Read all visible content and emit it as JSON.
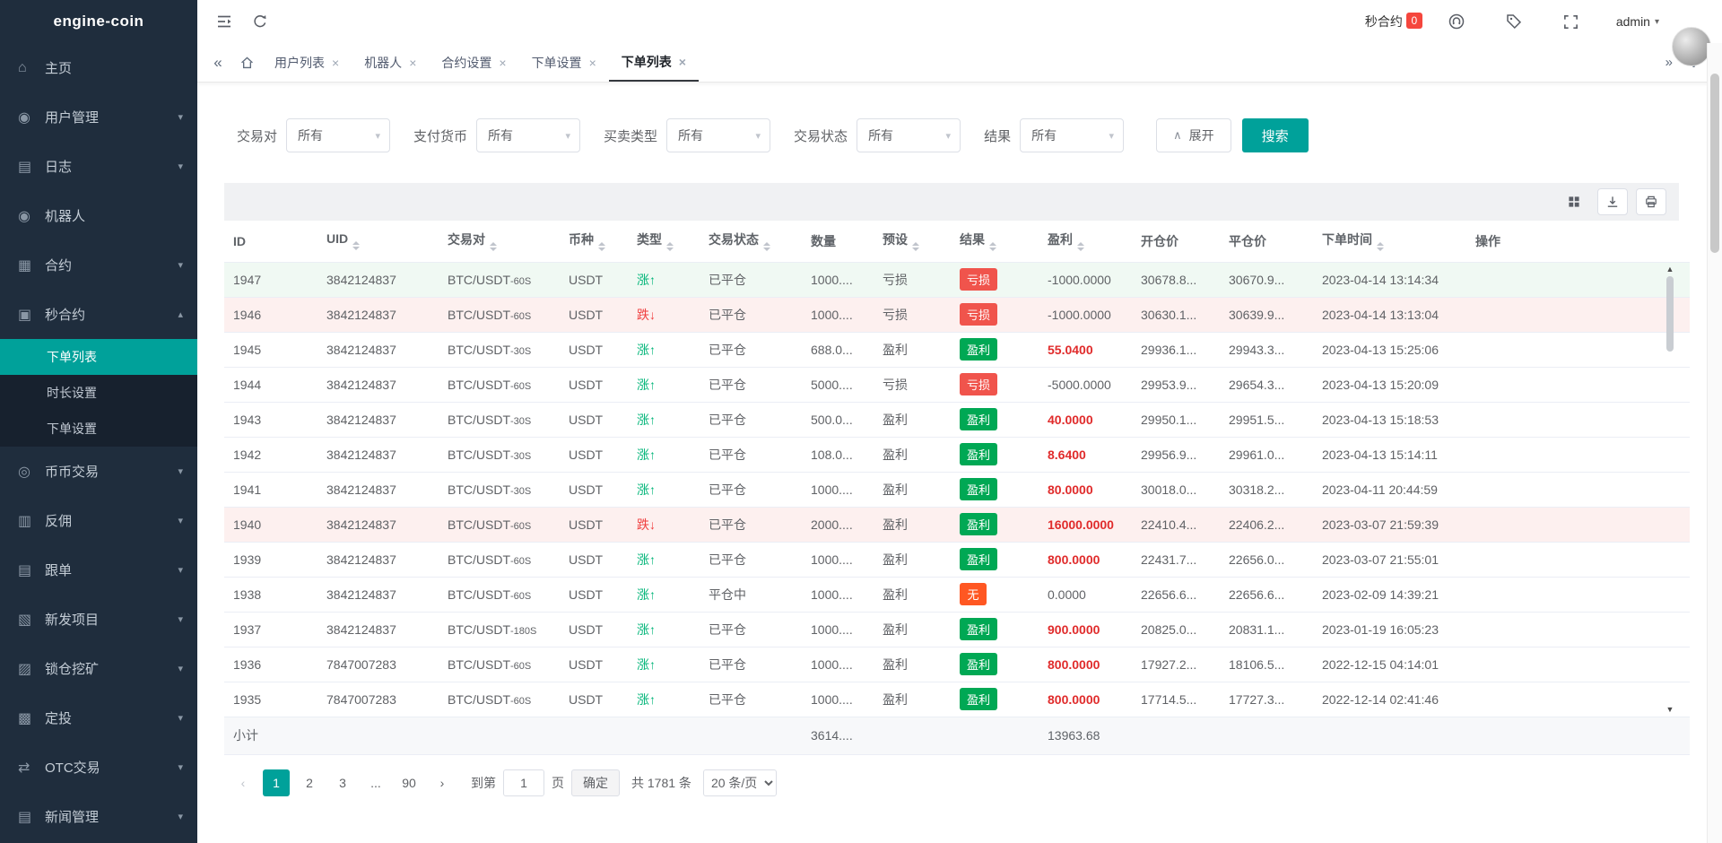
{
  "brand": "engine-coin",
  "colors": {
    "accent": "#00a19a",
    "sidebar_bg": "#1f2d3d",
    "submenu_bg": "#17212e",
    "badge_red": "#f5463d",
    "win_green": "#00a854",
    "loss_red": "#f0544c",
    "none_orange": "#ff5722",
    "up_green": "#00b578",
    "down_red": "#f03e3e",
    "profit_red": "#e02b2b",
    "row_pink": "#fdf0ef",
    "row_green": "#f0f9f3"
  },
  "sidebar": {
    "items": [
      {
        "icon": "home",
        "label": "主页"
      },
      {
        "icon": "user",
        "label": "用户管理",
        "chevron": "down"
      },
      {
        "icon": "log",
        "label": "日志",
        "chevron": "down"
      },
      {
        "icon": "robot",
        "label": "机器人"
      },
      {
        "icon": "contract",
        "label": "合约",
        "chevron": "down"
      },
      {
        "icon": "seconds",
        "label": "秒合约",
        "chevron": "up",
        "expanded": true,
        "children": [
          {
            "label": "下单列表",
            "active": true
          },
          {
            "label": "时长设置"
          },
          {
            "label": "下单设置"
          }
        ]
      },
      {
        "icon": "coin",
        "label": "币币交易",
        "chevron": "down"
      },
      {
        "icon": "rebate",
        "label": "反佣",
        "chevron": "down"
      },
      {
        "icon": "follow",
        "label": "跟单",
        "chevron": "down"
      },
      {
        "icon": "newproj",
        "label": "新发项目",
        "chevron": "down"
      },
      {
        "icon": "lock",
        "label": "锁仓挖矿",
        "chevron": "down"
      },
      {
        "icon": "invest",
        "label": "定投",
        "chevron": "down"
      },
      {
        "icon": "otc",
        "label": "OTC交易",
        "chevron": "down"
      },
      {
        "icon": "news",
        "label": "新闻管理",
        "chevron": "down"
      }
    ]
  },
  "topbar": {
    "badge_label": "秒合约",
    "badge_count": "0",
    "username": "admin"
  },
  "tabs": [
    {
      "label": "用户列表"
    },
    {
      "label": "机器人"
    },
    {
      "label": "合约设置"
    },
    {
      "label": "下单设置"
    },
    {
      "label": "下单列表",
      "active": true
    }
  ],
  "filters": [
    {
      "label": "交易对",
      "value": "所有"
    },
    {
      "label": "支付货币",
      "value": "所有"
    },
    {
      "label": "买卖类型",
      "value": "所有"
    },
    {
      "label": "交易状态",
      "value": "所有"
    },
    {
      "label": "结果",
      "value": "所有"
    }
  ],
  "actions": {
    "expand": "展开",
    "search": "搜索"
  },
  "table": {
    "columns": [
      {
        "label": "ID",
        "sortable": false
      },
      {
        "label": "UID",
        "sortable": true
      },
      {
        "label": "交易对",
        "sortable": true
      },
      {
        "label": "币种",
        "sortable": true
      },
      {
        "label": "类型",
        "sortable": true
      },
      {
        "label": "交易状态",
        "sortable": true
      },
      {
        "label": "数量",
        "sortable": false
      },
      {
        "label": "预设",
        "sortable": true
      },
      {
        "label": "结果",
        "sortable": true
      },
      {
        "label": "盈利",
        "sortable": true
      },
      {
        "label": "开仓价",
        "sortable": false
      },
      {
        "label": "平仓价",
        "sortable": false
      },
      {
        "label": "下单时间",
        "sortable": true
      },
      {
        "label": "操作",
        "sortable": false
      }
    ],
    "rows": [
      {
        "id": "1947",
        "uid": "3842124837",
        "pair": "BTC/USDT",
        "period": "60S",
        "coin": "USDT",
        "type": "涨",
        "dir": "up",
        "status": "已平仓",
        "qty": "1000....",
        "preset": "亏损",
        "result": "亏损",
        "result_style": "loss",
        "profit": "-1000.0000",
        "profit_style": "plain",
        "open": "30678.8...",
        "close": "30670.9...",
        "time": "2023-04-14 13:14:34",
        "bg": "green"
      },
      {
        "id": "1946",
        "uid": "3842124837",
        "pair": "BTC/USDT",
        "period": "60S",
        "coin": "USDT",
        "type": "跌",
        "dir": "down",
        "status": "已平仓",
        "qty": "1000....",
        "preset": "亏损",
        "result": "亏损",
        "result_style": "loss",
        "profit": "-1000.0000",
        "profit_style": "plain",
        "open": "30630.1...",
        "close": "30639.9...",
        "time": "2023-04-14 13:13:04",
        "bg": "pink"
      },
      {
        "id": "1945",
        "uid": "3842124837",
        "pair": "BTC/USDT",
        "period": "30S",
        "coin": "USDT",
        "type": "涨",
        "dir": "up",
        "status": "已平仓",
        "qty": "688.0...",
        "preset": "盈利",
        "result": "盈利",
        "result_style": "win",
        "profit": "55.0400",
        "profit_style": "red",
        "open": "29936.1...",
        "close": "29943.3...",
        "time": "2023-04-13 15:25:06",
        "bg": "white"
      },
      {
        "id": "1944",
        "uid": "3842124837",
        "pair": "BTC/USDT",
        "period": "60S",
        "coin": "USDT",
        "type": "涨",
        "dir": "up",
        "status": "已平仓",
        "qty": "5000....",
        "preset": "亏损",
        "result": "亏损",
        "result_style": "loss",
        "profit": "-5000.0000",
        "profit_style": "plain",
        "open": "29953.9...",
        "close": "29654.3...",
        "time": "2023-04-13 15:20:09",
        "bg": "white"
      },
      {
        "id": "1943",
        "uid": "3842124837",
        "pair": "BTC/USDT",
        "period": "30S",
        "coin": "USDT",
        "type": "涨",
        "dir": "up",
        "status": "已平仓",
        "qty": "500.0...",
        "preset": "盈利",
        "result": "盈利",
        "result_style": "win",
        "profit": "40.0000",
        "profit_style": "red",
        "open": "29950.1...",
        "close": "29951.5...",
        "time": "2023-04-13 15:18:53",
        "bg": "white"
      },
      {
        "id": "1942",
        "uid": "3842124837",
        "pair": "BTC/USDT",
        "period": "30S",
        "coin": "USDT",
        "type": "涨",
        "dir": "up",
        "status": "已平仓",
        "qty": "108.0...",
        "preset": "盈利",
        "result": "盈利",
        "result_style": "win",
        "profit": "8.6400",
        "profit_style": "red",
        "open": "29956.9...",
        "close": "29961.0...",
        "time": "2023-04-13 15:14:11",
        "bg": "white"
      },
      {
        "id": "1941",
        "uid": "3842124837",
        "pair": "BTC/USDT",
        "period": "30S",
        "coin": "USDT",
        "type": "涨",
        "dir": "up",
        "status": "已平仓",
        "qty": "1000....",
        "preset": "盈利",
        "result": "盈利",
        "result_style": "win",
        "profit": "80.0000",
        "profit_style": "red",
        "open": "30018.0...",
        "close": "30318.2...",
        "time": "2023-04-11 20:44:59",
        "bg": "white"
      },
      {
        "id": "1940",
        "uid": "3842124837",
        "pair": "BTC/USDT",
        "period": "60S",
        "coin": "USDT",
        "type": "跌",
        "dir": "down",
        "status": "已平仓",
        "qty": "2000....",
        "preset": "盈利",
        "result": "盈利",
        "result_style": "win",
        "profit": "16000.0000",
        "profit_style": "red",
        "open": "22410.4...",
        "close": "22406.2...",
        "time": "2023-03-07 21:59:39",
        "bg": "pink"
      },
      {
        "id": "1939",
        "uid": "3842124837",
        "pair": "BTC/USDT",
        "period": "60S",
        "coin": "USDT",
        "type": "涨",
        "dir": "up",
        "status": "已平仓",
        "qty": "1000....",
        "preset": "盈利",
        "result": "盈利",
        "result_style": "win",
        "profit": "800.0000",
        "profit_style": "red",
        "open": "22431.7...",
        "close": "22656.0...",
        "time": "2023-03-07 21:55:01",
        "bg": "white"
      },
      {
        "id": "1938",
        "uid": "3842124837",
        "pair": "BTC/USDT",
        "period": "60S",
        "coin": "USDT",
        "type": "涨",
        "dir": "up",
        "status": "平仓中",
        "qty": "1000....",
        "preset": "盈利",
        "result": "无",
        "result_style": "none",
        "profit": "0.0000",
        "profit_style": "plain",
        "open": "22656.6...",
        "close": "22656.6...",
        "time": "2023-02-09 14:39:21",
        "bg": "white"
      },
      {
        "id": "1937",
        "uid": "3842124837",
        "pair": "BTC/USDT",
        "period": "180S",
        "coin": "USDT",
        "type": "涨",
        "dir": "up",
        "status": "已平仓",
        "qty": "1000....",
        "preset": "盈利",
        "result": "盈利",
        "result_style": "win",
        "profit": "900.0000",
        "profit_style": "red",
        "open": "20825.0...",
        "close": "20831.1...",
        "time": "2023-01-19 16:05:23",
        "bg": "white"
      },
      {
        "id": "1936",
        "uid": "7847007283",
        "pair": "BTC/USDT",
        "period": "60S",
        "coin": "USDT",
        "type": "涨",
        "dir": "up",
        "status": "已平仓",
        "qty": "1000....",
        "preset": "盈利",
        "result": "盈利",
        "result_style": "win",
        "profit": "800.0000",
        "profit_style": "red",
        "open": "17927.2...",
        "close": "18106.5...",
        "time": "2022-12-15 04:14:01",
        "bg": "white"
      },
      {
        "id": "1935",
        "uid": "7847007283",
        "pair": "BTC/USDT",
        "period": "60S",
        "coin": "USDT",
        "type": "涨",
        "dir": "up",
        "status": "已平仓",
        "qty": "1000....",
        "preset": "盈利",
        "result": "盈利",
        "result_style": "win",
        "profit": "800.0000",
        "profit_style": "red",
        "open": "17714.5...",
        "close": "17727.3...",
        "time": "2022-12-14 02:41:46",
        "bg": "white"
      }
    ],
    "subtotal": {
      "label": "小计",
      "qty": "3614....",
      "profit": "13963.68"
    }
  },
  "pagination": {
    "pages": [
      "1",
      "2",
      "3",
      "...",
      "90"
    ],
    "active": "1",
    "jump_label": "到第",
    "jump_value": "1",
    "jump_unit": "页",
    "confirm": "确定",
    "total": "共 1781 条",
    "page_size": "20 条/页"
  }
}
